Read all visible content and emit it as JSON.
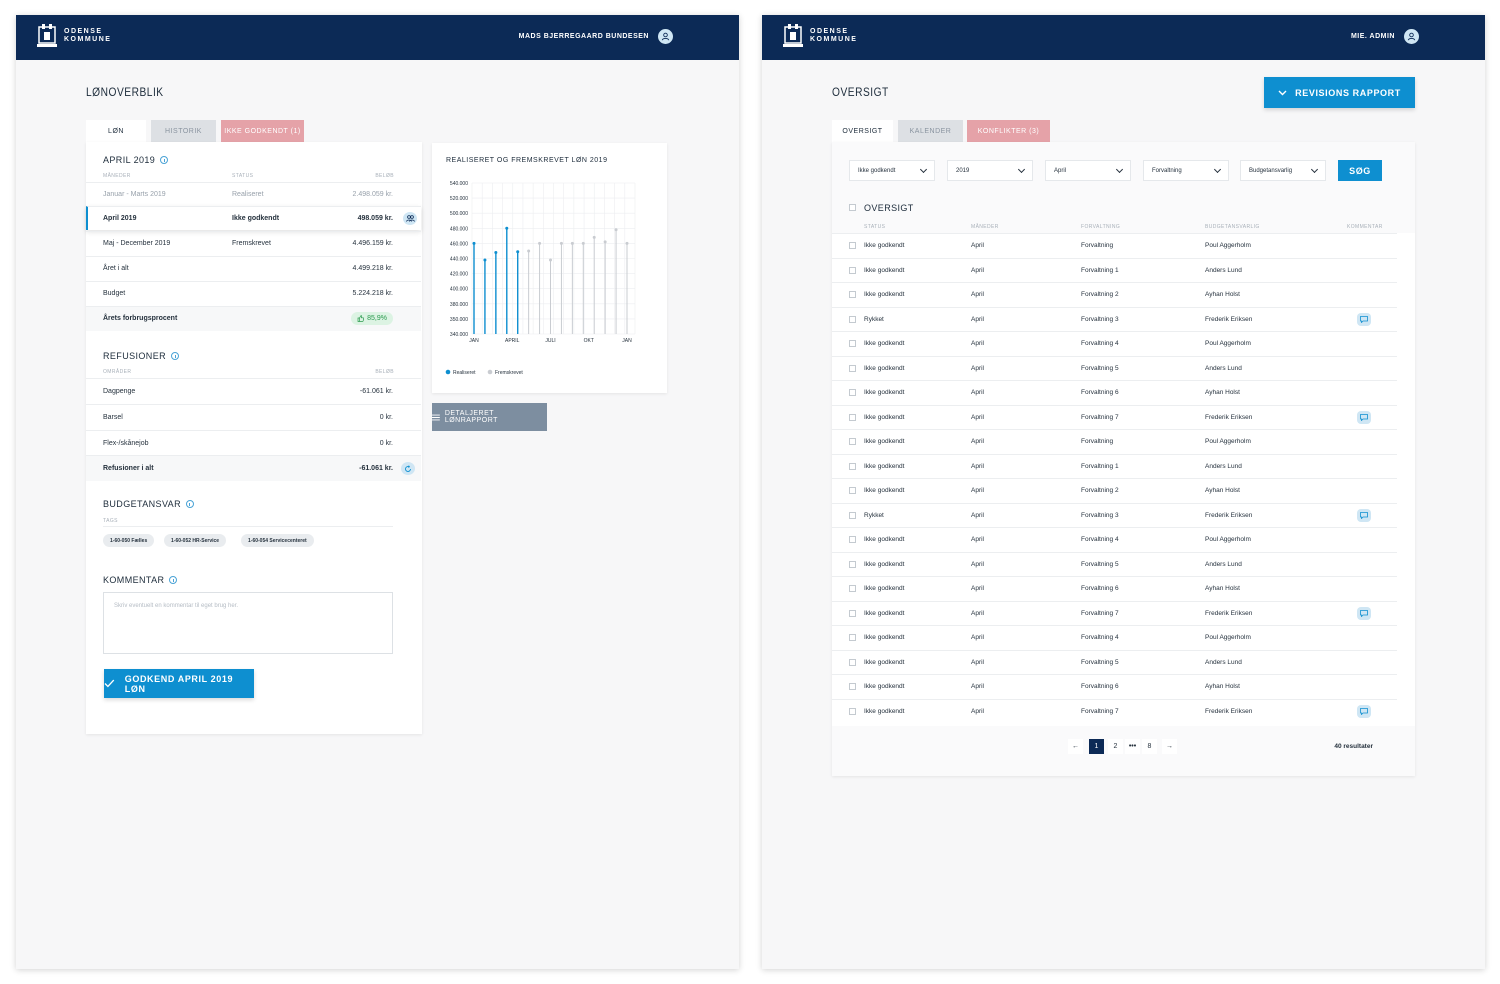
{
  "left": {
    "brand": {
      "line1": "ODENSE",
      "line2": "KOMMUNE"
    },
    "user": "MADS BJERREGAARD BUNDESEN",
    "page_title": "LØNOVERBLIK",
    "tabs": [
      {
        "label": "LØN",
        "state": "active"
      },
      {
        "label": "HISTORIK",
        "state": "inactive"
      },
      {
        "label": "IKKE GODKENDT (1)",
        "state": "alert"
      }
    ],
    "salary": {
      "title": "APRIL 2019",
      "col_headers": [
        "MÅNEDER",
        "STATUS",
        "BELØB"
      ],
      "rows": [
        {
          "month": "Januar - Marts 2019",
          "status": "Realiseret",
          "amount": "2.498.059 kr."
        },
        {
          "month": "April 2019",
          "status": "Ikke godkendt",
          "amount": "498.059 kr."
        },
        {
          "month": "Maj - December 2019",
          "status": "Fremskrevet",
          "amount": "4.496.159 kr."
        },
        {
          "month": "Året i alt",
          "status": "",
          "amount": "4.499.218 kr."
        },
        {
          "month": "Budget",
          "status": "",
          "amount": "5.224.218 kr."
        },
        {
          "month": "Årets forbrugsprocent",
          "status": "",
          "amount": "85,9%"
        }
      ]
    },
    "refusioner": {
      "title": "REFUSIONER",
      "col_headers": [
        "OMRÅDER",
        "BELØB"
      ],
      "rows": [
        {
          "area": "Dagpenge",
          "amount": "-61.061 kr."
        },
        {
          "area": "Barsel",
          "amount": "0 kr."
        },
        {
          "area": "Flex-/skånejob",
          "amount": "0 kr."
        },
        {
          "area": "Refusioner i alt",
          "amount": "-61.061 kr."
        }
      ]
    },
    "budgetansvar": {
      "title": "BUDGETANSVAR",
      "col_header": "TAGS",
      "tags": [
        "1-60-050 Fælles",
        "1-60-052 HR-Service",
        "1-60-054 Servicecenteret"
      ]
    },
    "kommentar": {
      "title": "KOMMENTAR",
      "placeholder": "Skriv eventuelt en kommentar til eget brug her."
    },
    "approve_button": "GODKEND APRIL 2019 LØN",
    "report_button": "DETALJERET LØNRAPPORT",
    "chart_title": "REALISERET OG FREMSKREVET LØN 2019"
  },
  "chart_data": {
    "type": "bar",
    "title": "REALISERET OG FREMSKREVET LØN 2019",
    "xlabel": "",
    "ylabel": "",
    "x_tick_labels": [
      "JAN",
      "APRIL",
      "JULI",
      "OKT",
      "JAN"
    ],
    "y_tick_labels": [
      "540.000",
      "520.000",
      "500.000",
      "480.000",
      "460.000",
      "440.000",
      "420.000",
      "400.000",
      "380.000",
      "350.000",
      "340.000"
    ],
    "ylim": [
      340000,
      540000
    ],
    "grid": true,
    "legend": "bottom-left",
    "series": [
      {
        "name": "Realiseret",
        "color": "#0e8fd0",
        "values": [
          460000,
          438000,
          448000,
          480000,
          449000,
          null,
          null,
          null,
          null,
          null,
          null,
          null,
          null,
          null
        ]
      },
      {
        "name": "Fremskrevet",
        "color": "#c9ccd1",
        "values": [
          null,
          null,
          null,
          null,
          null,
          450000,
          460000,
          438000,
          460000,
          460000,
          460000,
          468000,
          462000,
          478000,
          460000
        ]
      }
    ]
  },
  "right": {
    "brand": {
      "line1": "ODENSE",
      "line2": "KOMMUNE"
    },
    "user": "MIE. ADMIN",
    "page_title": "OVERSIGT",
    "revision_button": "REVISIONS RAPPORT",
    "tabs": [
      {
        "label": "OVERSIGT",
        "state": "active"
      },
      {
        "label": "KALENDER",
        "state": "inactive"
      },
      {
        "label": "KONFLIKTER (3)",
        "state": "alert"
      }
    ],
    "filters": [
      "Ikke godkendt",
      "2019",
      "April",
      "Forvaltning",
      "Budgetansvarlig"
    ],
    "search_button": "SØG",
    "table_title": "OVERSIGT",
    "col_headers": [
      "STATUS",
      "MÅNEDER",
      "FORVALTNING",
      "BUDGETANSVARLIG",
      "KOMMENTAR"
    ],
    "rows": [
      {
        "status": "Ikke godkendt",
        "month": "April",
        "dept": "Forvaltning",
        "owner": "Poul Aggerholm",
        "comment": false
      },
      {
        "status": "Ikke godkendt",
        "month": "April",
        "dept": "Forvaltning 1",
        "owner": "Anders Lund",
        "comment": false
      },
      {
        "status": "Ikke godkendt",
        "month": "April",
        "dept": "Forvaltning 2",
        "owner": "Ayhan Holst",
        "comment": false
      },
      {
        "status": "Rykket",
        "month": "April",
        "dept": "Forvaltning 3",
        "owner": "Frederik Eriksen",
        "comment": true
      },
      {
        "status": "Ikke godkendt",
        "month": "April",
        "dept": "Forvaltning 4",
        "owner": "Poul Aggerholm",
        "comment": false
      },
      {
        "status": "Ikke godkendt",
        "month": "April",
        "dept": "Forvaltning 5",
        "owner": "Anders Lund",
        "comment": false
      },
      {
        "status": "Ikke godkendt",
        "month": "April",
        "dept": "Forvaltning 6",
        "owner": "Ayhan Holst",
        "comment": false
      },
      {
        "status": "Ikke godkendt",
        "month": "April",
        "dept": "Forvaltning 7",
        "owner": "Frederik Eriksen",
        "comment": true
      },
      {
        "status": "Ikke godkendt",
        "month": "April",
        "dept": "Forvaltning",
        "owner": "Poul Aggerholm",
        "comment": false
      },
      {
        "status": "Ikke godkendt",
        "month": "April",
        "dept": "Forvaltning 1",
        "owner": "Anders Lund",
        "comment": false
      },
      {
        "status": "Ikke godkendt",
        "month": "April",
        "dept": "Forvaltning 2",
        "owner": "Ayhan Holst",
        "comment": false
      },
      {
        "status": "Rykket",
        "month": "April",
        "dept": "Forvaltning 3",
        "owner": "Frederik Eriksen",
        "comment": true
      },
      {
        "status": "Ikke godkendt",
        "month": "April",
        "dept": "Forvaltning 4",
        "owner": "Poul Aggerholm",
        "comment": false
      },
      {
        "status": "Ikke godkendt",
        "month": "April",
        "dept": "Forvaltning 5",
        "owner": "Anders Lund",
        "comment": false
      },
      {
        "status": "Ikke godkendt",
        "month": "April",
        "dept": "Forvaltning 6",
        "owner": "Ayhan Holst",
        "comment": false
      },
      {
        "status": "Ikke godkendt",
        "month": "April",
        "dept": "Forvaltning 7",
        "owner": "Frederik Eriksen",
        "comment": true
      },
      {
        "status": "Ikke godkendt",
        "month": "April",
        "dept": "Forvaltning 4",
        "owner": "Poul Aggerholm",
        "comment": false
      },
      {
        "status": "Ikke godkendt",
        "month": "April",
        "dept": "Forvaltning 5",
        "owner": "Anders Lund",
        "comment": false
      },
      {
        "status": "Ikke godkendt",
        "month": "April",
        "dept": "Forvaltning 6",
        "owner": "Ayhan Holst",
        "comment": false
      },
      {
        "status": "Ikke godkendt",
        "month": "April",
        "dept": "Forvaltning 7",
        "owner": "Frederik Eriksen",
        "comment": true
      }
    ],
    "pagination": {
      "pages": [
        "1",
        "2",
        "•••",
        "8"
      ],
      "current": "1",
      "prev": "←",
      "next": "→",
      "results": "40 resultater"
    }
  },
  "colors": {
    "navy": "#0c2a56",
    "accent": "#0e8fd0",
    "alert": "#e5a2a8",
    "success": "#2b9a4f",
    "projected": "#c9ccd1"
  }
}
